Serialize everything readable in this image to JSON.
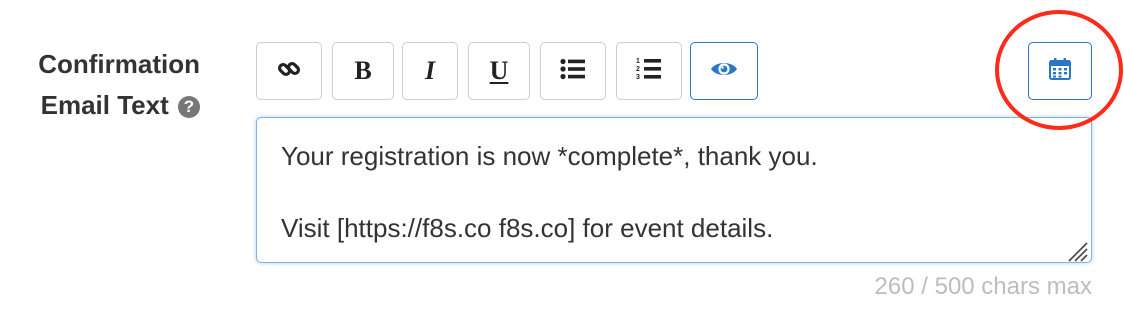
{
  "field": {
    "label_line1": "Confirmation",
    "label_line2": "Email Text",
    "help_glyph": "?"
  },
  "toolbar": {
    "buttons": [
      {
        "name": "link-button",
        "icon": "link-icon"
      },
      {
        "name": "bold-button",
        "glyph": "B"
      },
      {
        "name": "italic-button",
        "glyph": "I"
      },
      {
        "name": "underline-button",
        "glyph": "U"
      },
      {
        "name": "bulleted-list-button",
        "icon": "bulleted-list-icon"
      },
      {
        "name": "numbered-list-button",
        "icon": "numbered-list-icon"
      },
      {
        "name": "preview-button",
        "icon": "eye-icon",
        "active": true
      },
      {
        "name": "calendar-button",
        "icon": "calendar-icon",
        "active": true
      }
    ]
  },
  "editor": {
    "line1": "Your registration is now *complete*, thank you.",
    "line2": "",
    "line3": "Visit [https://f8s.co f8s.co] for event details."
  },
  "counter": {
    "text": "260 / 500 chars max"
  },
  "colors": {
    "accent": "#2a78c5",
    "highlight": "#ff2a1a",
    "muted": "#bdbdbd"
  }
}
